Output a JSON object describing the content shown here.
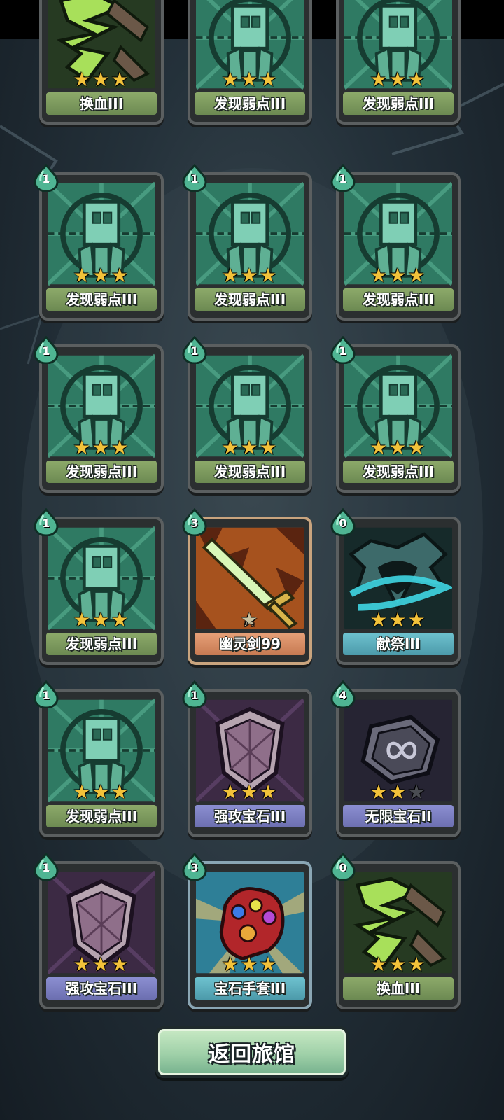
{
  "cards": [
    {
      "label": "换血III",
      "art": "swap-art",
      "stars": 3,
      "max_stars": 3,
      "label_color": "green",
      "cost": ""
    },
    {
      "label": "发现弱点III",
      "art": "target-art",
      "stars": 3,
      "max_stars": 3,
      "label_color": "green",
      "cost": ""
    },
    {
      "label": "发现弱点III",
      "art": "target-art",
      "stars": 3,
      "max_stars": 3,
      "label_color": "green",
      "cost": ""
    },
    {
      "label": "发现弱点III",
      "art": "target-art",
      "stars": 3,
      "max_stars": 3,
      "label_color": "green",
      "cost": "1"
    },
    {
      "label": "发现弱点III",
      "art": "target-art",
      "stars": 3,
      "max_stars": 3,
      "label_color": "green",
      "cost": "1"
    },
    {
      "label": "发现弱点III",
      "art": "target-art",
      "stars": 3,
      "max_stars": 3,
      "label_color": "green",
      "cost": "1"
    },
    {
      "label": "发现弱点III",
      "art": "target-art",
      "stars": 3,
      "max_stars": 3,
      "label_color": "green",
      "cost": "1"
    },
    {
      "label": "发现弱点III",
      "art": "target-art",
      "stars": 3,
      "max_stars": 3,
      "label_color": "green",
      "cost": "1"
    },
    {
      "label": "发现弱点III",
      "art": "target-art",
      "stars": 3,
      "max_stars": 3,
      "label_color": "green",
      "cost": "1"
    },
    {
      "label": "发现弱点III",
      "art": "target-art",
      "stars": 3,
      "max_stars": 3,
      "label_color": "green",
      "cost": "1"
    },
    {
      "label": "幽灵剑99",
      "art": "sword-art",
      "stars": 1,
      "max_stars": 1,
      "star_text": "99",
      "label_color": "orange",
      "cost": "3"
    },
    {
      "label": "献祭III",
      "art": "ghost-art",
      "stars": 3,
      "max_stars": 3,
      "label_color": "teal",
      "cost": "0"
    },
    {
      "label": "发现弱点III",
      "art": "target-art",
      "stars": 3,
      "max_stars": 3,
      "label_color": "green",
      "cost": "1"
    },
    {
      "label": "强攻宝石III",
      "art": "gem-art",
      "stars": 3,
      "max_stars": 3,
      "label_color": "purple",
      "cost": "1"
    },
    {
      "label": "无限宝石II",
      "art": "infinity-gem-art",
      "stars": 2,
      "max_stars": 3,
      "label_color": "purple",
      "cost": "4"
    },
    {
      "label": "强攻宝石III",
      "art": "gem-art",
      "stars": 3,
      "max_stars": 3,
      "label_color": "purple",
      "cost": "1"
    },
    {
      "label": "宝石手套III",
      "art": "gauntlet-art",
      "stars": 3,
      "max_stars": 3,
      "label_color": "teal",
      "cost": "3"
    },
    {
      "label": "换血III",
      "art": "swap-art",
      "stars": 3,
      "max_stars": 3,
      "label_color": "green",
      "cost": "0"
    }
  ],
  "back_button": {
    "label": "返回旅馆"
  },
  "colors": {
    "accent": "#9fd0a8",
    "star": "#f2c23a",
    "background": "#24313a"
  }
}
